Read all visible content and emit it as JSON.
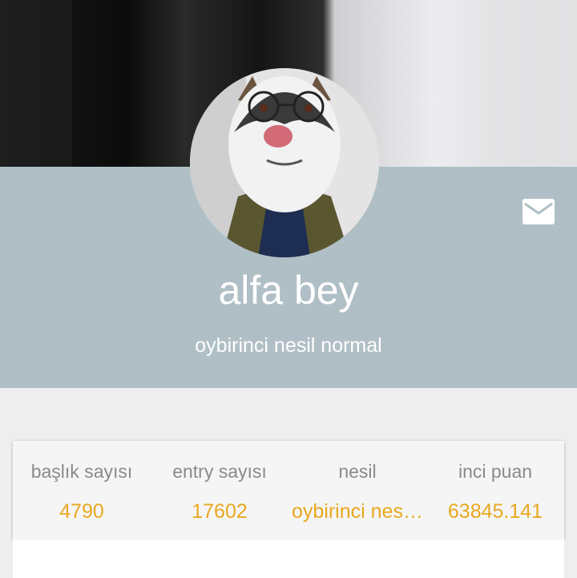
{
  "profile": {
    "username": "alfa bey",
    "generation_label": "oybirinci nesil normal"
  },
  "icons": {
    "avatar": "husky-with-glasses-avatar",
    "message": "mail-icon"
  },
  "stats": [
    {
      "label": "başlık sayısı",
      "value": "4790"
    },
    {
      "label": "entry sayısı",
      "value": "17602"
    },
    {
      "label": "nesil",
      "value": "oybirinci nesi..."
    },
    {
      "label": "inci puan",
      "value": "63845.141"
    }
  ],
  "colors": {
    "band": "#b0bfc6",
    "accent": "#e9a81f",
    "label": "#8a8a8a",
    "background": "#eeeeee"
  }
}
